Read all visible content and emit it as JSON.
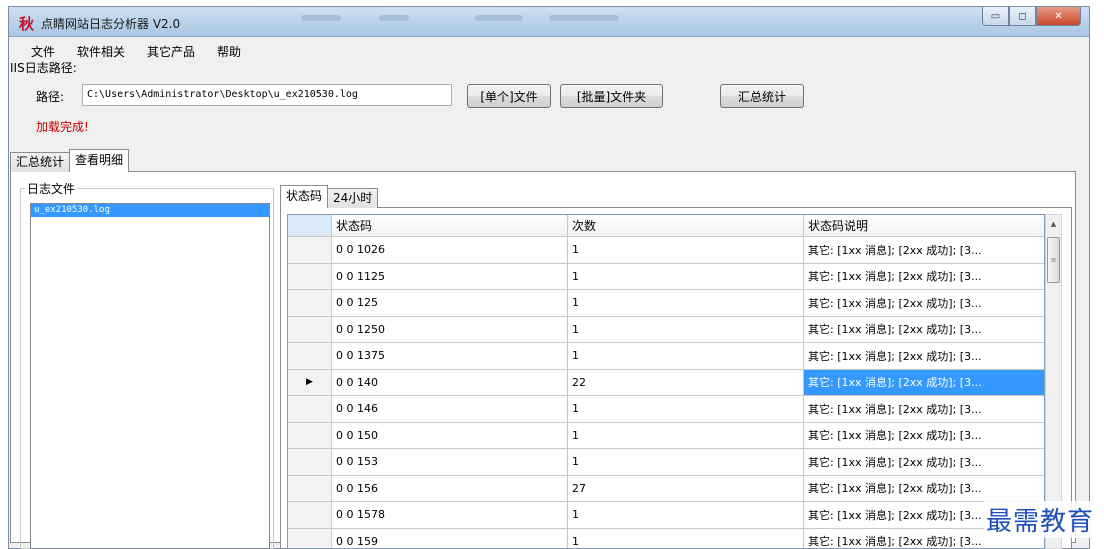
{
  "window": {
    "title": "点睛网站日志分析器 V2.0",
    "app_icon_char": "秋",
    "controls": {
      "minimize": "▭",
      "maximize": "◻",
      "close": "✕"
    }
  },
  "menu": [
    "文件",
    "软件相关",
    "其它产品",
    "帮助"
  ],
  "iis_label": "IIS日志路径:",
  "path": {
    "label": "路径:",
    "value": "C:\\Users\\Administrator\\Desktop\\u_ex210530.log"
  },
  "buttons": {
    "single_file": "[单个]文件",
    "batch_folder": "[批量]文件夹",
    "summary": "汇总统计"
  },
  "status": "加载完成!",
  "outer_tabs": [
    "汇总统计",
    "查看明细"
  ],
  "log_files": {
    "label": "日志文件",
    "items": [
      "u_ex210530.log"
    ]
  },
  "inner_tabs": [
    "状态码",
    "24小时"
  ],
  "grid": {
    "columns": [
      "状态码",
      "次数",
      "状态码说明"
    ],
    "rows": [
      {
        "code": "0 0 1026",
        "count": "1",
        "desc": "其它: [1xx 消息]; [2xx 成功]; [3..."
      },
      {
        "code": "0 0 1125",
        "count": "1",
        "desc": "其它: [1xx 消息]; [2xx 成功]; [3..."
      },
      {
        "code": "0 0 125",
        "count": "1",
        "desc": "其它: [1xx 消息]; [2xx 成功]; [3..."
      },
      {
        "code": "0 0 1250",
        "count": "1",
        "desc": "其它: [1xx 消息]; [2xx 成功]; [3..."
      },
      {
        "code": "0 0 1375",
        "count": "1",
        "desc": "其它: [1xx 消息]; [2xx 成功]; [3..."
      },
      {
        "code": "0 0 140",
        "count": "22",
        "desc": "其它: [1xx 消息]; [2xx 成功]; [3...",
        "selected": true
      },
      {
        "code": "0 0 146",
        "count": "1",
        "desc": "其它: [1xx 消息]; [2xx 成功]; [3..."
      },
      {
        "code": "0 0 150",
        "count": "1",
        "desc": "其它: [1xx 消息]; [2xx 成功]; [3..."
      },
      {
        "code": "0 0 153",
        "count": "1",
        "desc": "其它: [1xx 消息]; [2xx 成功]; [3..."
      },
      {
        "code": "0 0 156",
        "count": "27",
        "desc": "其它: [1xx 消息]; [2xx 成功]; [3..."
      },
      {
        "code": "0 0 1578",
        "count": "1",
        "desc": "其它: [1xx 消息]; [2xx 成功]; [3..."
      },
      {
        "code": "0 0 159",
        "count": "1",
        "desc": "其它: [1xx 消息]; [2xx 成功]; [3..."
      }
    ],
    "current_row_marker": "▶"
  },
  "scrollbar": {
    "up_arrow": "▲",
    "thumb_grip": "≡"
  },
  "watermark": "最需教育"
}
